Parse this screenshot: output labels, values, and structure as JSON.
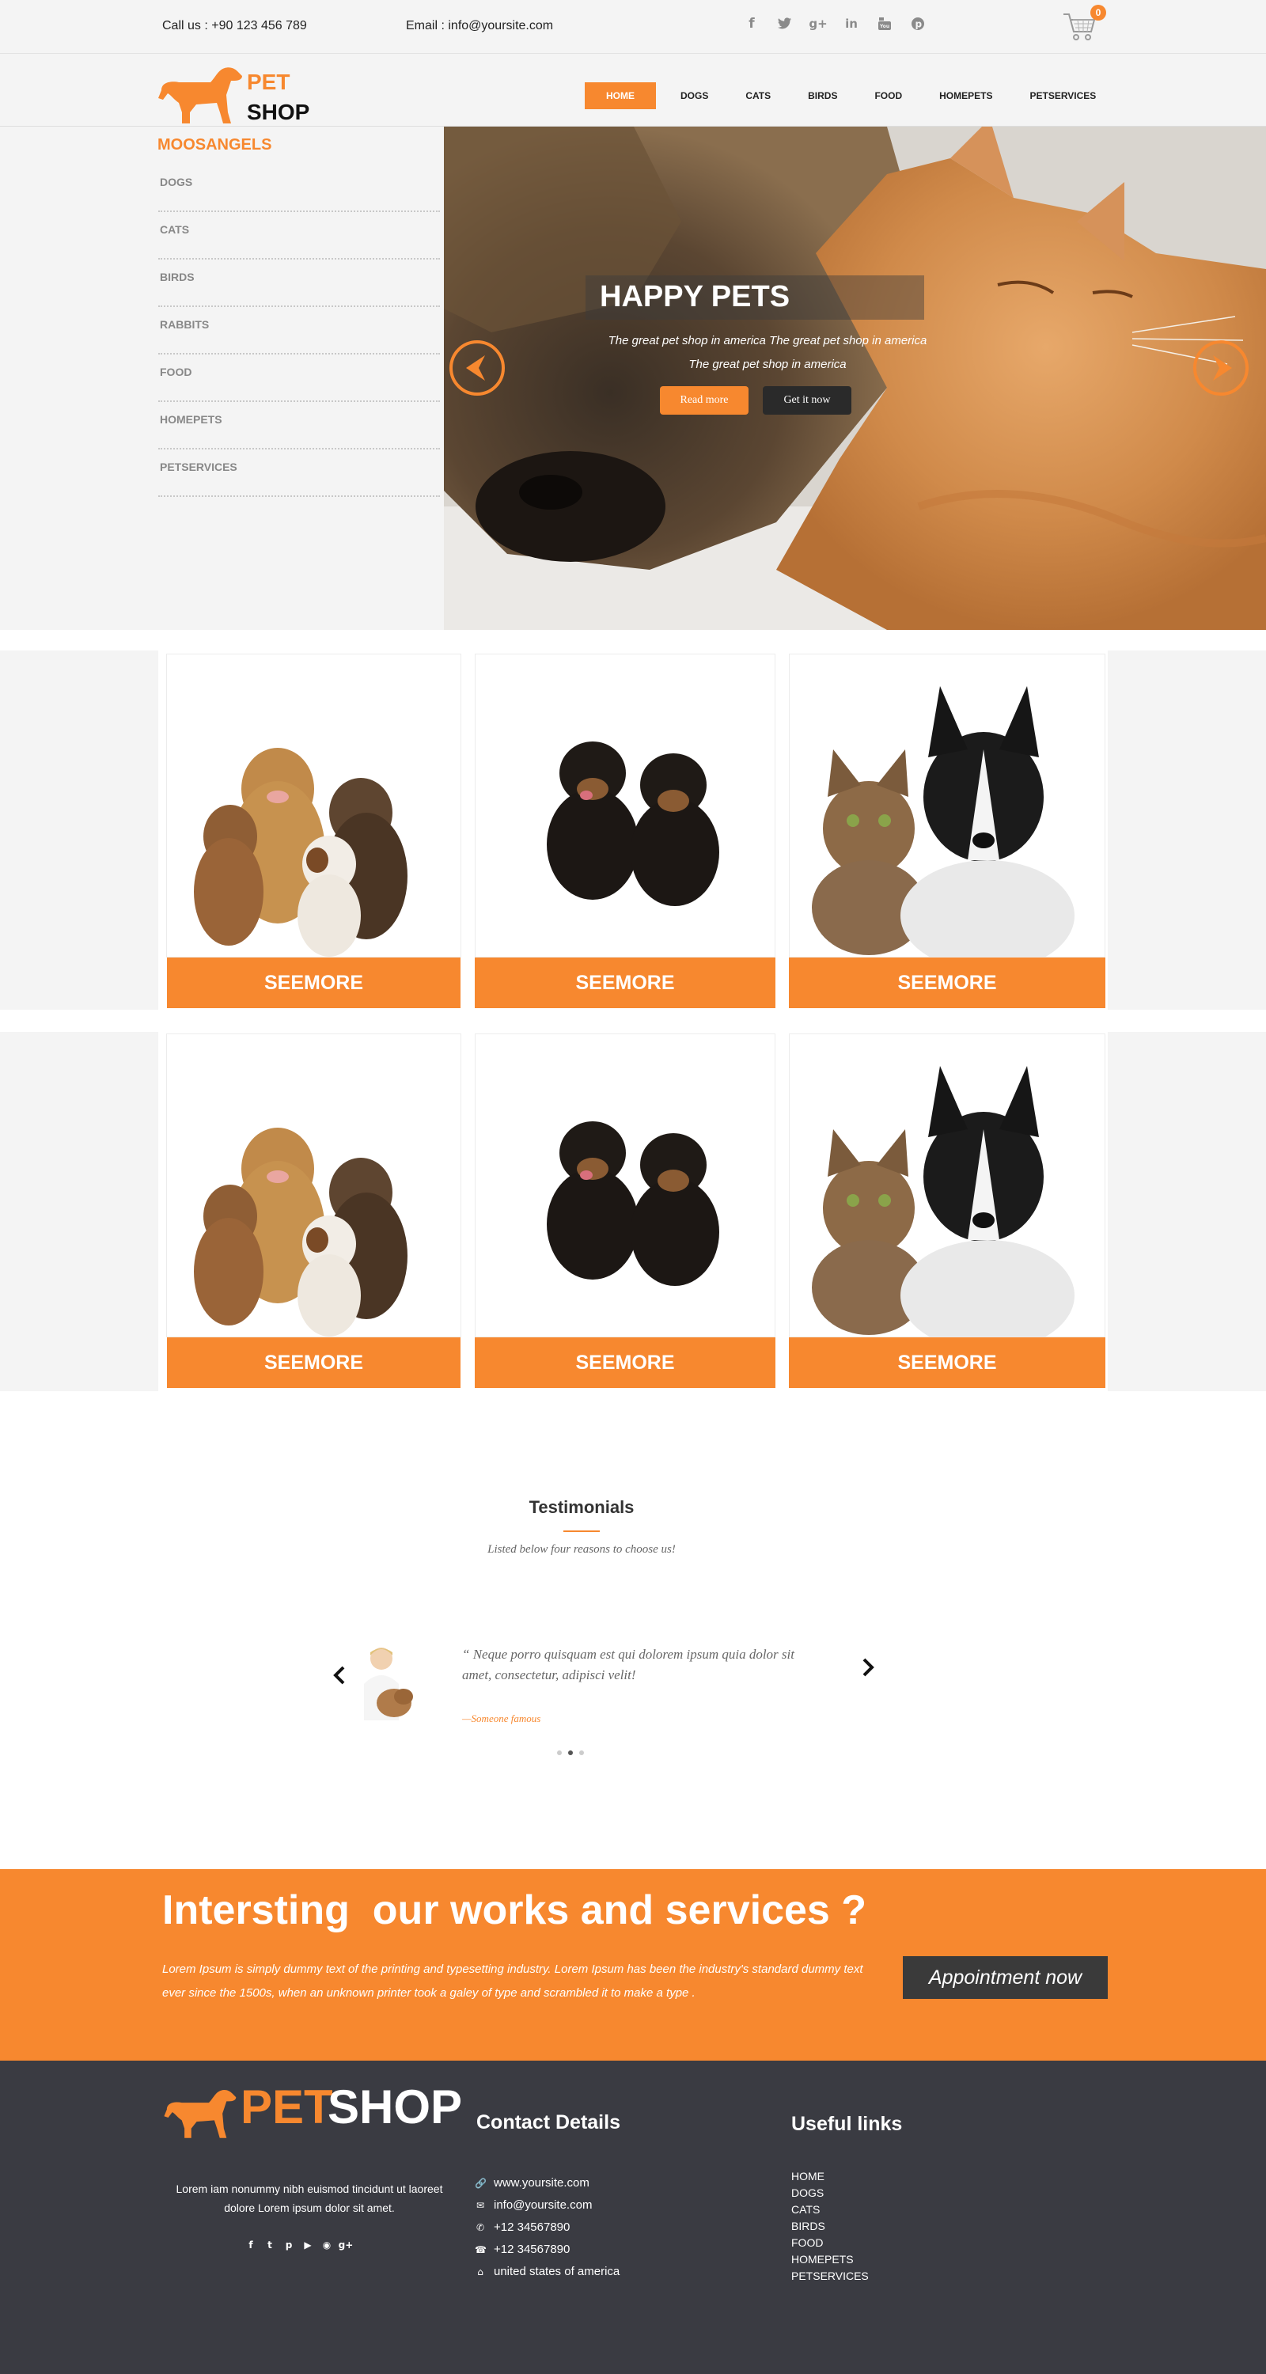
{
  "topbar": {
    "call_label": "Call us :",
    "call_value": "+90  123 456 789",
    "email_label": "Email :",
    "email_value": "info@yoursite.com",
    "social_icons": [
      "facebook-icon",
      "twitter-icon",
      "google-plus-icon",
      "linkedin-icon",
      "youtube-icon",
      "pinterest-icon"
    ],
    "cart_count": "0"
  },
  "logo": {
    "pet": "PET",
    "shop": "SHOP"
  },
  "nav": [
    "HOME",
    "DOGS",
    "CATS",
    "BIRDS",
    "FOOD",
    "HOMEPETS",
    "PETSERVICES"
  ],
  "sidebar": {
    "title": "MOOSANGELS",
    "items": [
      "DOGS",
      "CATS",
      "BIRDS",
      "RABBITS",
      "FOOD",
      "HOMEPETS",
      "PETSERVICES"
    ]
  },
  "slider": {
    "title": "HAPPY PETS",
    "text_line1": "The great pet shop in america The great pet shop in america",
    "text_line2": "The great pet shop in america",
    "read_more": "Read more",
    "get_it_now": "Get it now"
  },
  "products": {
    "button_label": "SEEMORE"
  },
  "testimonials": {
    "title": "Testimonials",
    "subtitle": "Listed below four reasons to choose us!",
    "quote": "“ Neque porro quisquam est qui dolorem ipsum quia dolor sit amet, consectetur, adipisci velit!",
    "author": "—Someone famous"
  },
  "band": {
    "title": "Intersting  our works and services ?",
    "text": "Lorem Ipsum is simply dummy text of the printing and typesetting industry. Lorem Ipsum has been the industry's standard dummy text ever since the 1500s, when an unknown printer took a galey of type and scrambled it to make a type .",
    "button": "Appointment now"
  },
  "footer": {
    "logo_pet": "PET",
    "logo_shop": "SHOP",
    "about": "Lorem iam nonummy nibh euismod tincidunt ut laoreet dolore Lorem ipsum dolor sit amet.",
    "contact_title": "Contact Details",
    "contacts": [
      "www.yoursite.com",
      "info@yoursite.com",
      "+12 34567890",
      "+12 34567890",
      "united states of america"
    ],
    "links_title": "Useful links",
    "links": [
      "HOME",
      "DOGS",
      "CATS",
      "BIRDS",
      "FOOD",
      "HOMEPETS",
      "PETSERVICES"
    ]
  },
  "colors": {
    "accent": "#f7882f",
    "dark": "#3a3b42",
    "light_bg": "#f4f4f4"
  }
}
